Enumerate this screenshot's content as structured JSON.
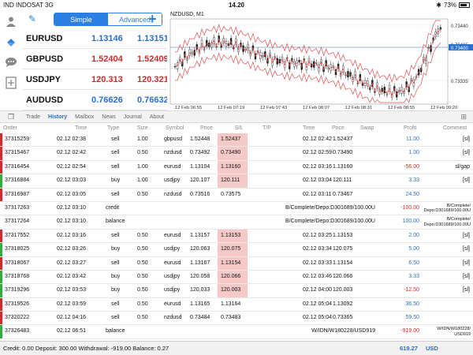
{
  "status": {
    "carrier": "IND INDOSAT 3G",
    "time": "14.20",
    "battery": "73%"
  },
  "quotes": {
    "tab_simple": "Simple",
    "tab_advanced": "Advanced",
    "rows": [
      {
        "symbol": "EURUSD",
        "bid": "1.13146",
        "ask": "1.13151",
        "bid_color": "blue",
        "ask_color": "blue"
      },
      {
        "symbol": "GBPUSD",
        "bid": "1.52404",
        "ask": "1.52409",
        "bid_color": "red",
        "ask_color": "red"
      },
      {
        "symbol": "USDJPY",
        "bid": "120.313",
        "ask": "120.321",
        "bid_color": "red",
        "ask_color": "red"
      },
      {
        "symbol": "AUDUSD",
        "bid": "0.76626",
        "ask": "0.76632",
        "bid_color": "blue",
        "ask_color": "blue"
      }
    ]
  },
  "chart": {
    "title": "NZDUSD, M1",
    "price_labels": [
      "0.73440",
      "0.73405",
      "0.73400",
      "0.73335"
    ],
    "current_price": "0.73400",
    "time_labels": [
      "12 Feb 06:55",
      "12 Feb 07:19",
      "12 Feb 07:43",
      "12 Feb 08:07",
      "12 Feb 08:31",
      "12 Feb 08:55",
      "12 Feb 09:20"
    ]
  },
  "tabs": [
    "Trade",
    "History",
    "Mailbox",
    "News",
    "Journal",
    "About"
  ],
  "active_tab": "History",
  "columns": {
    "order": "Order",
    "time": "Time",
    "type": "Type",
    "size": "Size",
    "symbol": "Symbol",
    "price": "Price",
    "sl": "S/L",
    "tp": "T/P",
    "time2": "Time",
    "price2": "Price",
    "swap": "Swap",
    "profit": "Profit",
    "comment": "Comment"
  },
  "rows": [
    {
      "order": "37315259",
      "time": "02.12 02:38",
      "type": "sell",
      "size": "1.00",
      "symbol": "gbpusd",
      "price": "1.52448",
      "sl": "1.52437",
      "time2": "02.12 02:42",
      "price2": "1.52437",
      "profit": "11.00",
      "comment": "[sl]",
      "marker": "red",
      "sl_hl": true,
      "pcolor": "blue"
    },
    {
      "order": "37315467",
      "time": "02.12 02:42",
      "type": "sell",
      "size": "0.50",
      "symbol": "nzdusd",
      "price": "0.73492",
      "sl": "0.73490",
      "time2": "02.12 02:59",
      "price2": "0.73490",
      "profit": "1.00",
      "comment": "[sl]",
      "marker": "red",
      "sl_hl": true,
      "pcolor": "blue"
    },
    {
      "order": "37316454",
      "time": "02.12 02:54",
      "type": "sell",
      "size": "1.00",
      "symbol": "eurusd",
      "price": "1.13104",
      "sl": "1.13160",
      "time2": "02.12 03:16",
      "price2": "1.13160",
      "profit": "-56.00",
      "comment": "sl/gap",
      "marker": "red",
      "sl_hl": true,
      "pcolor": "red"
    },
    {
      "order": "37316884",
      "time": "02.12 03:03",
      "type": "buy",
      "size": "1.00",
      "symbol": "usdjpy",
      "price": "120.107",
      "sl": "120.111",
      "time2": "02.12 03:04",
      "price2": "120.111",
      "profit": "3.33",
      "comment": "[sl]",
      "marker": "green",
      "sl_hl": true,
      "pcolor": "blue"
    },
    {
      "order": "37316987",
      "time": "02.12 03:05",
      "type": "sell",
      "size": "0.50",
      "symbol": "nzdusd",
      "price": "0.73516",
      "sl": "0.73575",
      "time2": "02.12 03:11",
      "price2": "0.73467",
      "profit": "24.50",
      "comment": "",
      "marker": "red",
      "sl_hl": false,
      "pcolor": "blue"
    },
    {
      "order": "37317263",
      "time": "02.12 03:10",
      "type": "credit",
      "mid": "B/Complete/Depo:D301689/100.00U",
      "profit": "-100.00",
      "comment1": "B/Complete/",
      "comment2": "Depo:D301689/100.00U",
      "marker": "none",
      "pcolor": "red",
      "special": true
    },
    {
      "order": "37317264",
      "time": "02.12 03:10",
      "type": "balance",
      "mid": "B/Complete/Depo:D301689/100.00U",
      "profit": "100.00",
      "comment1": "B/Complete/",
      "comment2": "Depo:D301689/100.00U",
      "marker": "none",
      "pcolor": "blue",
      "special": true
    },
    {
      "order": "37317552",
      "time": "02.12 03:16",
      "type": "sell",
      "size": "0.50",
      "symbol": "eurusd",
      "price": "1.13157",
      "sl": "1.13153",
      "time2": "02.12 03:25",
      "price2": "1.13153",
      "profit": "2.00",
      "comment": "[sl]",
      "marker": "red",
      "sl_hl": true,
      "pcolor": "blue"
    },
    {
      "order": "37318025",
      "time": "02.12 03:26",
      "type": "buy",
      "size": "0.50",
      "symbol": "usdjpy",
      "price": "120.063",
      "sl": "120.075",
      "time2": "02.12 03:34",
      "price2": "120.075",
      "profit": "5.00",
      "comment": "[sl]",
      "marker": "green",
      "sl_hl": true,
      "pcolor": "blue"
    },
    {
      "order": "37318067",
      "time": "02.12 03:27",
      "type": "sell",
      "size": "0.50",
      "symbol": "eurusd",
      "price": "1.13167",
      "sl": "1.13154",
      "time2": "02.12 03:33",
      "price2": "1.13154",
      "profit": "6.50",
      "comment": "[sl]",
      "marker": "red",
      "sl_hl": true,
      "pcolor": "blue"
    },
    {
      "order": "37318768",
      "time": "02.12 03:42",
      "type": "buy",
      "size": "0.50",
      "symbol": "usdjpy",
      "price": "120.058",
      "sl": "120.066",
      "time2": "02.12 03:46",
      "price2": "120.066",
      "profit": "3.33",
      "comment": "[sl]",
      "marker": "green",
      "sl_hl": true,
      "pcolor": "blue"
    },
    {
      "order": "37319296",
      "time": "02.12 03:53",
      "type": "buy",
      "size": "0.50",
      "symbol": "usdjpy",
      "price": "120.033",
      "sl": "120.003",
      "time2": "02.12 04:00",
      "price2": "120.003",
      "profit": "-12.50",
      "comment": "[sl]",
      "marker": "green",
      "sl_hl": true,
      "pcolor": "red"
    },
    {
      "order": "37319526",
      "time": "02.12 03:59",
      "type": "sell",
      "size": "0.50",
      "symbol": "eurusd",
      "price": "1.13165",
      "sl": "1.13164",
      "time2": "02.12 05:04",
      "price2": "1.13092",
      "profit": "36.50",
      "comment": "",
      "marker": "red",
      "sl_hl": false,
      "pcolor": "blue"
    },
    {
      "order": "37320222",
      "time": "02.12 04:16",
      "type": "sell",
      "size": "0.50",
      "symbol": "nzdusd",
      "price": "0.73484",
      "sl": "0.73483",
      "time2": "02.12 05:04",
      "price2": "0.73365",
      "profit": "59.50",
      "comment": "",
      "marker": "red",
      "sl_hl": false,
      "pcolor": "blue"
    },
    {
      "order": "37326483",
      "time": "02.12 06:51",
      "type": "balance",
      "mid": "W/IDN/W180228/USD919",
      "profit": "-919.00",
      "comment1": "W/IDN/W180228/",
      "comment2": "USD919",
      "marker": "green",
      "pcolor": "red",
      "special": true
    }
  ],
  "footer": {
    "summary": "Credit: 0.00 Deposit: 300.00 Withdrawal: -919.00 Balance: 0.27",
    "total": "619.27",
    "currency": "USD"
  }
}
